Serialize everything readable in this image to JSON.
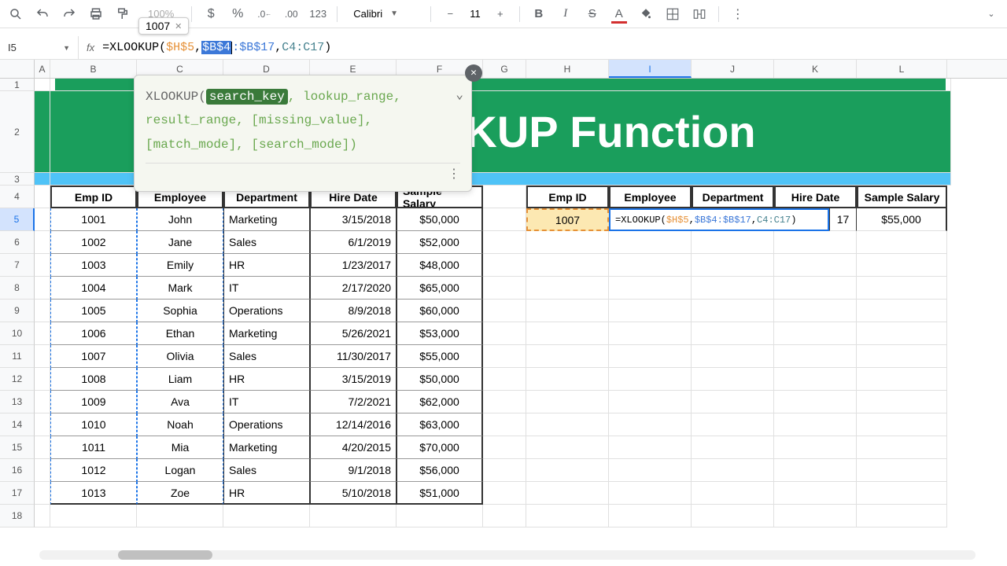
{
  "toolbar": {
    "zoom": "100%",
    "zoom_tip": "1007",
    "font_name": "Calibri",
    "font_size": "11",
    "format_number": "123"
  },
  "namebox": "I5",
  "formula": {
    "prefix": "=XLOOKUP(",
    "arg1": "$H$5",
    "sep": ",",
    "arg2a": "$B$4",
    "arg2b": ":$B$17",
    "arg3": "C4:C17",
    "suffix": ")"
  },
  "tooltip": {
    "fn": "XLOOKUP(",
    "active_arg": "search_key",
    "args_rest1": ", lookup_range,",
    "line2": "result_range, [missing_value],",
    "line3": "[match_mode], [search_mode])"
  },
  "columns": [
    "A",
    "B",
    "C",
    "D",
    "E",
    "F",
    "G",
    "H",
    "I",
    "J",
    "K",
    "L"
  ],
  "banner_text": "KUP Function",
  "headers": [
    "Emp ID",
    "Employee",
    "Department",
    "Hire Date",
    "Sample Salary"
  ],
  "table": [
    {
      "id": "1001",
      "emp": "John",
      "dept": "Marketing",
      "date": "3/15/2018",
      "sal": "$50,000"
    },
    {
      "id": "1002",
      "emp": "Jane",
      "dept": "Sales",
      "date": "6/1/2019",
      "sal": "$52,000"
    },
    {
      "id": "1003",
      "emp": "Emily",
      "dept": "HR",
      "date": "1/23/2017",
      "sal": "$48,000"
    },
    {
      "id": "1004",
      "emp": "Mark",
      "dept": "IT",
      "date": "2/17/2020",
      "sal": "$65,000"
    },
    {
      "id": "1005",
      "emp": "Sophia",
      "dept": "Operations",
      "date": "8/9/2018",
      "sal": "$60,000"
    },
    {
      "id": "1006",
      "emp": "Ethan",
      "dept": "Marketing",
      "date": "5/26/2021",
      "sal": "$53,000"
    },
    {
      "id": "1007",
      "emp": "Olivia",
      "dept": "Sales",
      "date": "11/30/2017",
      "sal": "$55,000"
    },
    {
      "id": "1008",
      "emp": "Liam",
      "dept": "HR",
      "date": "3/15/2019",
      "sal": "$50,000"
    },
    {
      "id": "1009",
      "emp": "Ava",
      "dept": "IT",
      "date": "7/2/2021",
      "sal": "$62,000"
    },
    {
      "id": "1010",
      "emp": "Noah",
      "dept": "Operations",
      "date": "12/14/2016",
      "sal": "$63,000"
    },
    {
      "id": "1011",
      "emp": "Mia",
      "dept": "Marketing",
      "date": "4/20/2015",
      "sal": "$70,000"
    },
    {
      "id": "1012",
      "emp": "Logan",
      "dept": "Sales",
      "date": "9/1/2018",
      "sal": "$56,000"
    },
    {
      "id": "1013",
      "emp": "Zoe",
      "dept": "HR",
      "date": "5/10/2018",
      "sal": "$51,000"
    }
  ],
  "lookup": {
    "emp_id": "1007",
    "formula_prefix": "=XLOOKUP(",
    "formula_a1": "$H$5",
    "formula_a2": "$B$4:$B$17",
    "formula_a3": "C4:C17",
    "formula_suffix": ")",
    "hiredate_frag": "17",
    "salary": "$55,000"
  },
  "row_heights": {
    "r1": 16,
    "r2": 104,
    "r3": 16,
    "data": 29
  }
}
